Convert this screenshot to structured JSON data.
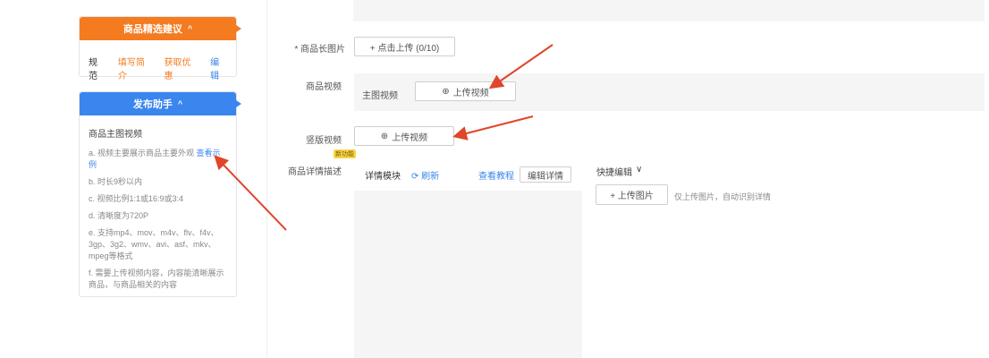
{
  "left": {
    "card1": {
      "title": "商品精选建议",
      "caret": "^",
      "label": "规范",
      "links": [
        "填写简介",
        "获取优惠",
        "编辑"
      ]
    },
    "card2": {
      "title": "发布助手",
      "caret": "^",
      "hint_title": "商品主图视频",
      "items": [
        "a. 视频主要展示商品主要外观",
        "b. 时长9秒以内",
        "c. 视频比例1:1或16:9或3:4",
        "d. 清晰度为720P",
        "e. 支持mp4、mov、m4v、flv、f4v、3gp、3g2、wmv、avi、asf、mkv、mpeg等格式",
        "f. 需要上传视频内容，内容能清晰展示商品，与商品相关的内容"
      ],
      "item1_link": "查看示例"
    }
  },
  "form": {
    "row1": {
      "label": "* 商品长图片",
      "button": "+ 点击上传 (0/10)"
    },
    "row2": {
      "label": "商品视频",
      "sublabel": "主图视频",
      "button": "上传视频"
    },
    "row3": {
      "label": "竖版视频",
      "button": "上传视频"
    },
    "row4": {
      "label": "商品详情描述",
      "badge": "新功能",
      "left_label": "详情模块",
      "left_link": "刷新",
      "left_link2": "查看教程",
      "left_button": "编辑详情",
      "right_title": "快捷编辑",
      "right_button": "+ 上传图片",
      "right_hint": "仅上传图片，自动识别详情"
    }
  }
}
